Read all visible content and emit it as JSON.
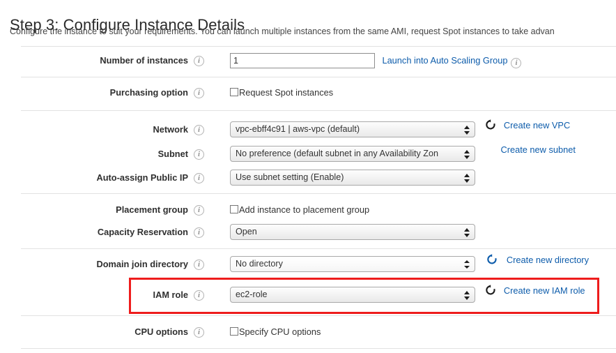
{
  "header": {
    "title": "Step 3: Configure Instance Details",
    "subtitle": "Configure the instance to suit your requirements. You can launch multiple instances from the same AMI, request Spot instances to take advan"
  },
  "form": {
    "number_of_instances": {
      "label": "Number of instances",
      "value": "1",
      "link": "Launch into Auto Scaling Group"
    },
    "purchasing_option": {
      "label": "Purchasing option",
      "checkbox_label": "Request Spot instances",
      "checked": false
    },
    "network": {
      "label": "Network",
      "value": "vpc-ebff4c91 | aws-vpc (default)",
      "link": "Create new VPC"
    },
    "subnet": {
      "label": "Subnet",
      "value": "No preference (default subnet in any Availability Zon",
      "link": "Create new subnet"
    },
    "auto_assign_public_ip": {
      "label": "Auto-assign Public IP",
      "value": "Use subnet setting (Enable)"
    },
    "placement_group": {
      "label": "Placement group",
      "checkbox_label": "Add instance to placement group",
      "checked": false
    },
    "capacity_reservation": {
      "label": "Capacity Reservation",
      "value": "Open"
    },
    "domain_join_directory": {
      "label": "Domain join directory",
      "value": "No directory",
      "link": "Create new directory"
    },
    "iam_role": {
      "label": "IAM role",
      "value": "ec2-role",
      "link": "Create new IAM role"
    },
    "cpu_options": {
      "label": "CPU options",
      "checkbox_label": "Specify CPU options",
      "checked": false
    }
  },
  "icons": {
    "info": "i"
  },
  "colors": {
    "link": "#0d5cab",
    "highlight": "#ee1c1c",
    "separator": "#e2e2e2"
  }
}
